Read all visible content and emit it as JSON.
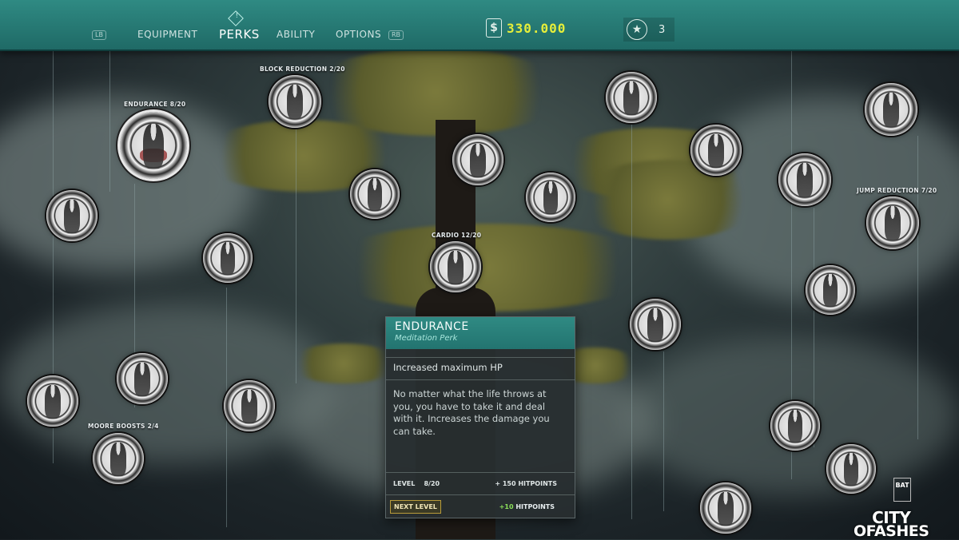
{
  "topbar": {
    "tag_left": "LB",
    "tag_right": "RB",
    "tabs": [
      "EQUIPMENT",
      "PERKS",
      "ABILITY",
      "OPTIONS"
    ],
    "active_tab": "PERKS",
    "currency_icon": "dollar-icon",
    "currency_value": "330.000",
    "points_icon": "star-icon",
    "points_value": "3",
    "accent_color": "#2f8a83",
    "currency_color": "#e5ee3a"
  },
  "perk_labels": {
    "block_reduction": "BLOCK REDUCTION  2/20",
    "endurance": "ENDURANCE  8/20",
    "cardio": "CARDIO  12/20",
    "jump_reduction": "JUMP REDUCTION 7/20",
    "moore_boosts": "MOORE BOOSTS 2/4"
  },
  "tooltip": {
    "title": "ENDURANCE",
    "subtitle": "Meditation Perk",
    "short_desc": "Increased maximum HP",
    "description": "No matter what the life throws at you, you have to take it and deal with it. Increases the damage you can take.",
    "level_label": "LEVEL",
    "level_value": "8/20",
    "current_bonus": "+ 150 HITPOINTS",
    "next_button": "NEXT LEVEL",
    "next_bonus_value": "+10",
    "next_bonus_unit": "HITPOINTS"
  },
  "logo": {
    "publisher": "BAT",
    "title_line1": "CITY",
    "title_line2": "OFASHES"
  }
}
